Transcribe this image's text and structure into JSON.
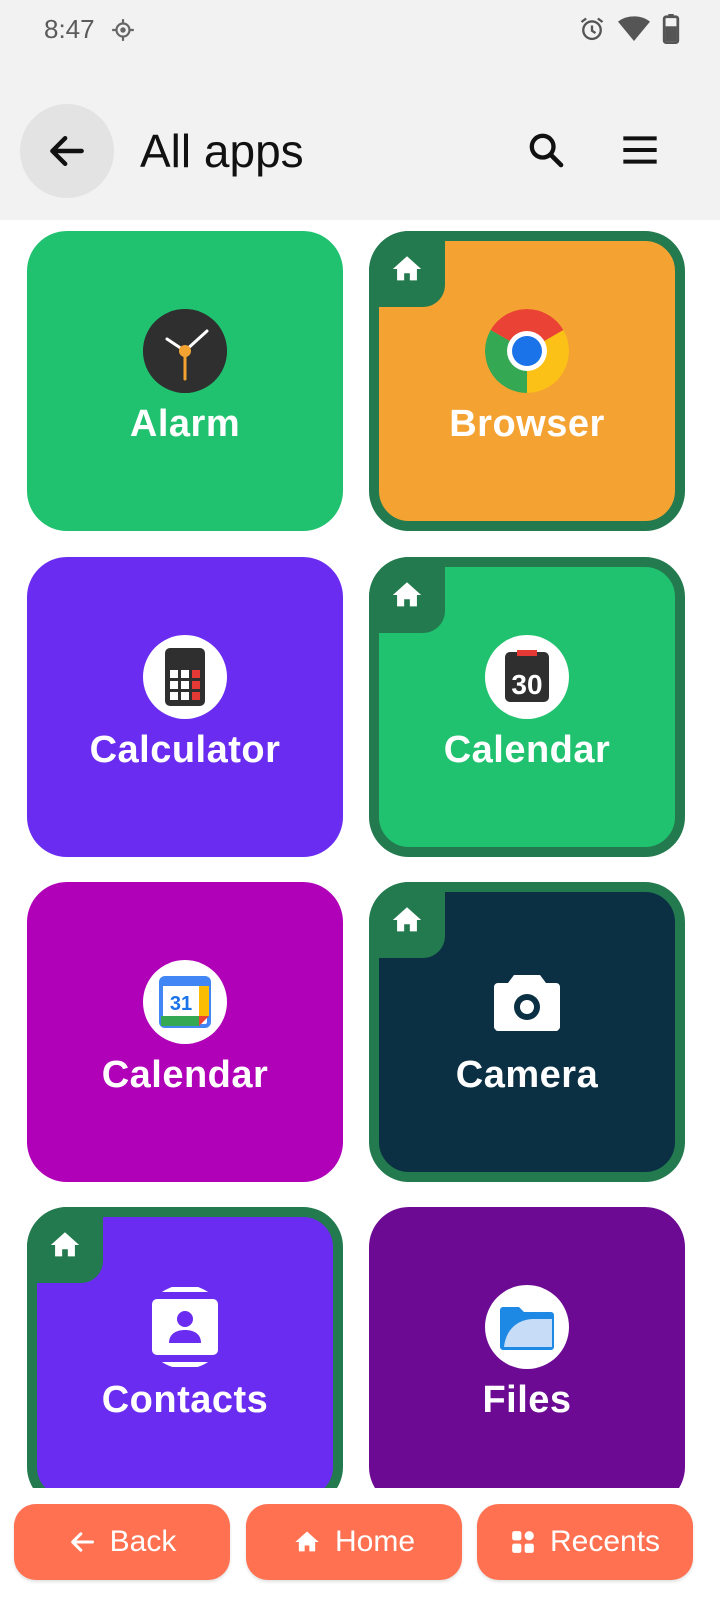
{
  "status": {
    "time": "8:47"
  },
  "header": {
    "title": "All apps"
  },
  "apps": [
    {
      "label": "Alarm",
      "color": "#20c26f",
      "pinned": false,
      "icon": "clock-icon"
    },
    {
      "label": "Browser",
      "color": "#f4a332",
      "pinned": true,
      "icon": "chrome-icon"
    },
    {
      "label": "Calculator",
      "color": "#6a2cf0",
      "pinned": false,
      "icon": "calculator-icon"
    },
    {
      "label": "Calendar",
      "color": "#20c26f",
      "pinned": true,
      "icon": "calendar-30-icon"
    },
    {
      "label": "Calendar",
      "color": "#b000b8",
      "pinned": false,
      "icon": "google-calendar-31-icon"
    },
    {
      "label": "Camera",
      "color": "#0b3044",
      "pinned": true,
      "icon": "camera-icon"
    },
    {
      "label": "Contacts",
      "color": "#6a2cf0",
      "pinned": true,
      "icon": "contacts-icon"
    },
    {
      "label": "Files",
      "color": "#6c0a94",
      "pinned": false,
      "icon": "files-icon"
    }
  ],
  "icons": {
    "calendar_day": "30",
    "gcal_day": "31"
  },
  "nav": {
    "back": "Back",
    "home": "Home",
    "recents": "Recents"
  },
  "colors": {
    "pinned_border": "#237a4e",
    "nav_button": "#ff7150",
    "header_bg": "#f2f2f2"
  }
}
